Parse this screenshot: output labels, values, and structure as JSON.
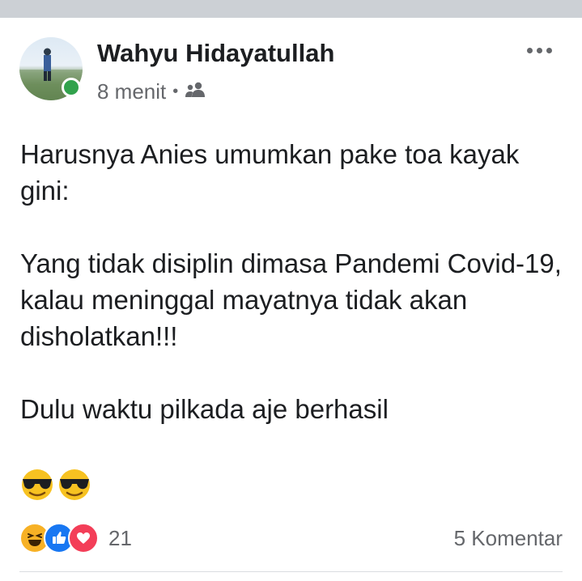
{
  "post": {
    "author": "Wahyu Hidayatullah",
    "time": "8 menit",
    "separator": "•",
    "audience_icon": "friends-icon",
    "more_icon": "more-options-icon",
    "body": [
      "Harusnya Anies umumkan pake toa kayak gini:",
      "",
      "Yang tidak disiplin dimasa Pandemi Covid-19, kalau meninggal mayatnya tidak akan disholatkan!!!",
      "",
      "Dulu waktu pilkada aje berhasil",
      ""
    ],
    "emojis": [
      "cool-sunglasses-emoji",
      "cool-sunglasses-emoji"
    ]
  },
  "footer": {
    "reactions": [
      "haha-reaction-icon",
      "like-reaction-icon",
      "love-reaction-icon"
    ],
    "reaction_count": "21",
    "comments": "5 Komentar"
  },
  "colors": {
    "online": "#31a24c",
    "like": "#1877f2",
    "love": "#f33e58",
    "haha": "#f7b125",
    "secondary_text": "#65676b"
  }
}
